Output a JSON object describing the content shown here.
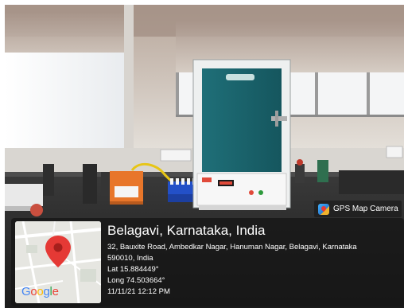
{
  "badge": {
    "label": "GPS Map Camera",
    "icon": "gps-map-camera-icon"
  },
  "map": {
    "logo_text": "Google",
    "pin_icon": "map-pin-icon",
    "logo_colors": [
      "#4285F4",
      "#EA4335",
      "#FBBC05",
      "#4285F4",
      "#34A853",
      "#EA4335"
    ],
    "pin_color": "#E53935"
  },
  "location": {
    "title": "Belagavi, Karnataka, India",
    "address_line1": "32, Bauxite Road, Ambedkar Nagar, Hanuman Nagar, Belagavi, Karnataka",
    "address_line2": "590010, India",
    "lat": "Lat 15.884449°",
    "long": "Long 74.503664°",
    "datetime": "11/11/21 12:12 PM"
  }
}
